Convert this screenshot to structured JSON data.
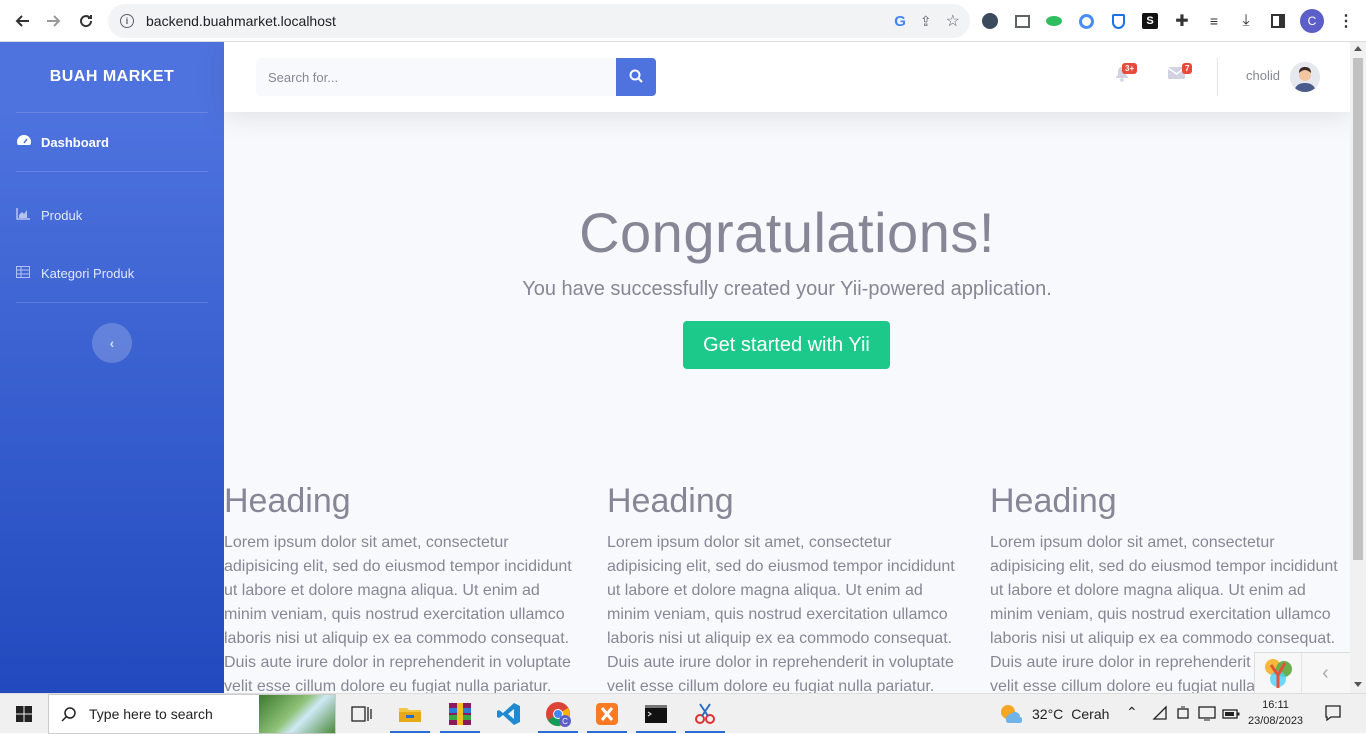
{
  "browser": {
    "url": "backend.buahmarket.localhost",
    "profile_initial": "C"
  },
  "sidebar": {
    "brand": "BUAH MARKET",
    "items": [
      {
        "label": "Dashboard",
        "icon": "tachometer-icon"
      },
      {
        "label": "Produk",
        "icon": "chart-area-icon"
      },
      {
        "label": "Kategori Produk",
        "icon": "table-icon"
      }
    ],
    "toggle_symbol": "‹"
  },
  "topbar": {
    "search_placeholder": "Search for...",
    "alerts_badge": "3+",
    "messages_badge": "7",
    "user_name": "cholid"
  },
  "hero": {
    "title": "Congratulations!",
    "lead": "You have successfully created your Yii-powered application.",
    "button": "Get started with Yii"
  },
  "columns": [
    {
      "heading": "Heading",
      "text": "Lorem ipsum dolor sit amet, consectetur adipisicing elit, sed do eiusmod tempor incididunt ut labore et dolore magna aliqua. Ut enim ad minim veniam, quis nostrud exercitation ullamco laboris nisi ut aliquip ex ea commodo consequat. Duis aute irure dolor in reprehenderit in voluptate velit esse cillum dolore eu fugiat nulla pariatur."
    },
    {
      "heading": "Heading",
      "text": "Lorem ipsum dolor sit amet, consectetur adipisicing elit, sed do eiusmod tempor incididunt ut labore et dolore magna aliqua. Ut enim ad minim veniam, quis nostrud exercitation ullamco laboris nisi ut aliquip ex ea commodo consequat. Duis aute irure dolor in reprehenderit in voluptate velit esse cillum dolore eu fugiat nulla pariatur."
    },
    {
      "heading": "Heading",
      "text": "Lorem ipsum dolor sit amet, consectetur adipisicing elit, sed do eiusmod tempor incididunt ut labore et dolore magna aliqua. Ut enim ad minim veniam, quis nostrud exercitation ullamco laboris nisi ut aliquip ex ea commodo consequat. Duis aute irure dolor in reprehenderit in voluptate velit esse cillum dolore eu fugiat nulla pariatur."
    }
  ],
  "taskbar": {
    "search_placeholder": "Type here to search",
    "weather_temp": "32°C",
    "weather_desc": "Cerah",
    "time": "16:11",
    "date": "23/08/2023"
  },
  "colors": {
    "primary": "#4e73df",
    "success": "#1cc88a",
    "danger": "#e74a3b",
    "text_muted": "#858796"
  }
}
